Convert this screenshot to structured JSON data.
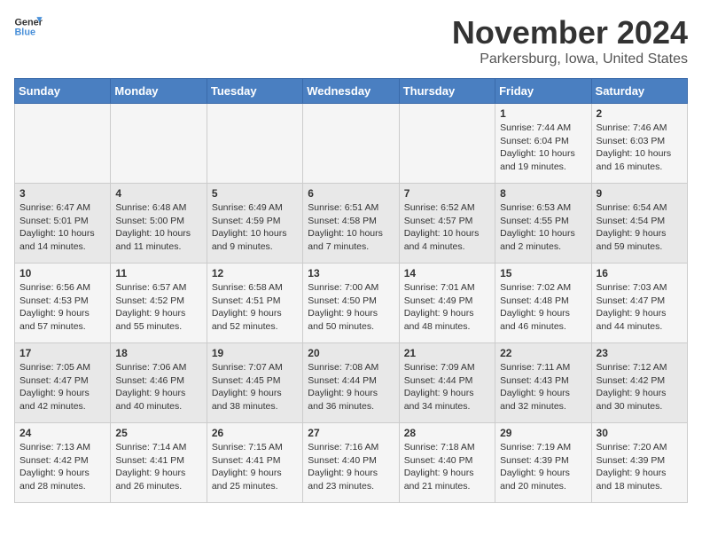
{
  "logo": {
    "line1": "General",
    "line2": "Blue"
  },
  "title": "November 2024",
  "location": "Parkersburg, Iowa, United States",
  "weekdays": [
    "Sunday",
    "Monday",
    "Tuesday",
    "Wednesday",
    "Thursday",
    "Friday",
    "Saturday"
  ],
  "weeks": [
    [
      {
        "day": "",
        "info": ""
      },
      {
        "day": "",
        "info": ""
      },
      {
        "day": "",
        "info": ""
      },
      {
        "day": "",
        "info": ""
      },
      {
        "day": "",
        "info": ""
      },
      {
        "day": "1",
        "info": "Sunrise: 7:44 AM\nSunset: 6:04 PM\nDaylight: 10 hours\nand 19 minutes."
      },
      {
        "day": "2",
        "info": "Sunrise: 7:46 AM\nSunset: 6:03 PM\nDaylight: 10 hours\nand 16 minutes."
      }
    ],
    [
      {
        "day": "3",
        "info": "Sunrise: 6:47 AM\nSunset: 5:01 PM\nDaylight: 10 hours\nand 14 minutes."
      },
      {
        "day": "4",
        "info": "Sunrise: 6:48 AM\nSunset: 5:00 PM\nDaylight: 10 hours\nand 11 minutes."
      },
      {
        "day": "5",
        "info": "Sunrise: 6:49 AM\nSunset: 4:59 PM\nDaylight: 10 hours\nand 9 minutes."
      },
      {
        "day": "6",
        "info": "Sunrise: 6:51 AM\nSunset: 4:58 PM\nDaylight: 10 hours\nand 7 minutes."
      },
      {
        "day": "7",
        "info": "Sunrise: 6:52 AM\nSunset: 4:57 PM\nDaylight: 10 hours\nand 4 minutes."
      },
      {
        "day": "8",
        "info": "Sunrise: 6:53 AM\nSunset: 4:55 PM\nDaylight: 10 hours\nand 2 minutes."
      },
      {
        "day": "9",
        "info": "Sunrise: 6:54 AM\nSunset: 4:54 PM\nDaylight: 9 hours\nand 59 minutes."
      }
    ],
    [
      {
        "day": "10",
        "info": "Sunrise: 6:56 AM\nSunset: 4:53 PM\nDaylight: 9 hours\nand 57 minutes."
      },
      {
        "day": "11",
        "info": "Sunrise: 6:57 AM\nSunset: 4:52 PM\nDaylight: 9 hours\nand 55 minutes."
      },
      {
        "day": "12",
        "info": "Sunrise: 6:58 AM\nSunset: 4:51 PM\nDaylight: 9 hours\nand 52 minutes."
      },
      {
        "day": "13",
        "info": "Sunrise: 7:00 AM\nSunset: 4:50 PM\nDaylight: 9 hours\nand 50 minutes."
      },
      {
        "day": "14",
        "info": "Sunrise: 7:01 AM\nSunset: 4:49 PM\nDaylight: 9 hours\nand 48 minutes."
      },
      {
        "day": "15",
        "info": "Sunrise: 7:02 AM\nSunset: 4:48 PM\nDaylight: 9 hours\nand 46 minutes."
      },
      {
        "day": "16",
        "info": "Sunrise: 7:03 AM\nSunset: 4:47 PM\nDaylight: 9 hours\nand 44 minutes."
      }
    ],
    [
      {
        "day": "17",
        "info": "Sunrise: 7:05 AM\nSunset: 4:47 PM\nDaylight: 9 hours\nand 42 minutes."
      },
      {
        "day": "18",
        "info": "Sunrise: 7:06 AM\nSunset: 4:46 PM\nDaylight: 9 hours\nand 40 minutes."
      },
      {
        "day": "19",
        "info": "Sunrise: 7:07 AM\nSunset: 4:45 PM\nDaylight: 9 hours\nand 38 minutes."
      },
      {
        "day": "20",
        "info": "Sunrise: 7:08 AM\nSunset: 4:44 PM\nDaylight: 9 hours\nand 36 minutes."
      },
      {
        "day": "21",
        "info": "Sunrise: 7:09 AM\nSunset: 4:44 PM\nDaylight: 9 hours\nand 34 minutes."
      },
      {
        "day": "22",
        "info": "Sunrise: 7:11 AM\nSunset: 4:43 PM\nDaylight: 9 hours\nand 32 minutes."
      },
      {
        "day": "23",
        "info": "Sunrise: 7:12 AM\nSunset: 4:42 PM\nDaylight: 9 hours\nand 30 minutes."
      }
    ],
    [
      {
        "day": "24",
        "info": "Sunrise: 7:13 AM\nSunset: 4:42 PM\nDaylight: 9 hours\nand 28 minutes."
      },
      {
        "day": "25",
        "info": "Sunrise: 7:14 AM\nSunset: 4:41 PM\nDaylight: 9 hours\nand 26 minutes."
      },
      {
        "day": "26",
        "info": "Sunrise: 7:15 AM\nSunset: 4:41 PM\nDaylight: 9 hours\nand 25 minutes."
      },
      {
        "day": "27",
        "info": "Sunrise: 7:16 AM\nSunset: 4:40 PM\nDaylight: 9 hours\nand 23 minutes."
      },
      {
        "day": "28",
        "info": "Sunrise: 7:18 AM\nSunset: 4:40 PM\nDaylight: 9 hours\nand 21 minutes."
      },
      {
        "day": "29",
        "info": "Sunrise: 7:19 AM\nSunset: 4:39 PM\nDaylight: 9 hours\nand 20 minutes."
      },
      {
        "day": "30",
        "info": "Sunrise: 7:20 AM\nSunset: 4:39 PM\nDaylight: 9 hours\nand 18 minutes."
      }
    ]
  ]
}
